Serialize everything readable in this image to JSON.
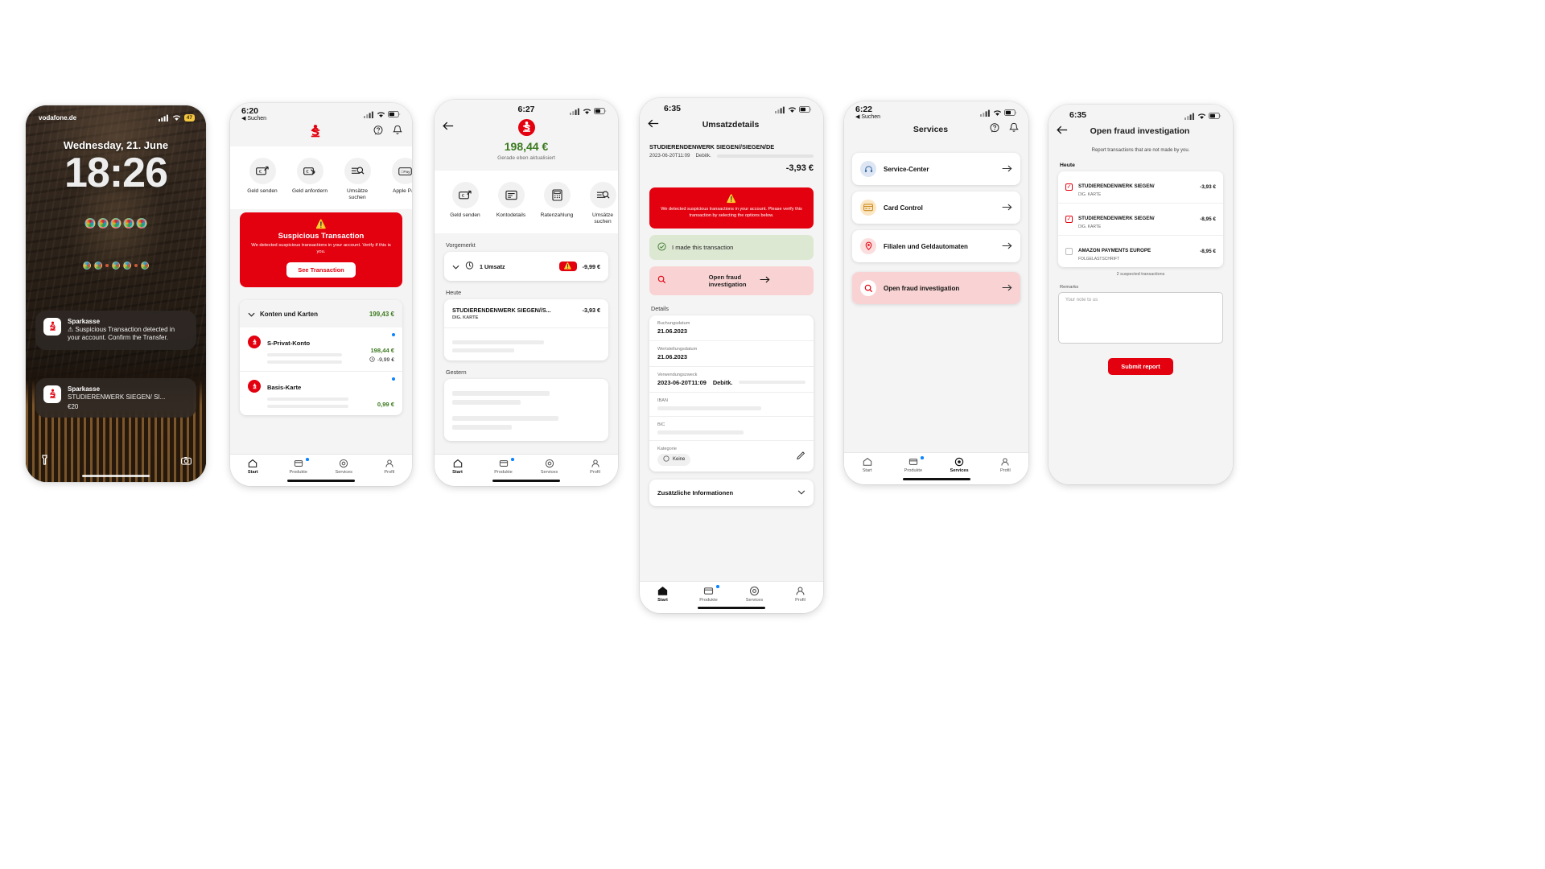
{
  "brand": {
    "name": "Sparkasse",
    "red": "#E3000F",
    "green": "#3B7A1E",
    "logo": "sparkasse-s-logo"
  },
  "phone1_lockscreen": {
    "carrier": "vodafone.de",
    "battery_badge": "47",
    "date": "Wednesday, 21. June",
    "time": "18:26",
    "notifications": [
      {
        "app": "Sparkasse",
        "text": "⚠ Suspicious Transaction detected in your account. Confirm the Transfer.",
        "amount": ""
      },
      {
        "app": "Sparkasse",
        "text": "STUDIERENWERK SIEGEN/ SI...",
        "amount": "€20"
      }
    ],
    "bottom_left_icon": "flashlight-icon",
    "bottom_right_icon": "camera-icon"
  },
  "phone2_home": {
    "status": {
      "time": "6:20",
      "back_label": "Suchen"
    },
    "nav": {
      "logo": "sparkasse-logo",
      "help_icon": "help-icon",
      "bell_icon": "bell-icon"
    },
    "quick_actions": [
      {
        "label": "Geld senden",
        "icon": "send-money-icon"
      },
      {
        "label": "Geld anfordern",
        "icon": "request-money-icon"
      },
      {
        "label": "Umsätze suchen",
        "icon": "search-transactions-icon"
      },
      {
        "label": "Apple Pay",
        "icon": "apple-pay-icon"
      }
    ],
    "alert": {
      "warn_icon": "warning-triangle-icon",
      "title": "Suspicious Transaction",
      "body": "We detected suspicious transactions in your account. Verify if this is you.",
      "button": "See Transaction"
    },
    "accounts": {
      "header": "Konten und Karten",
      "header_amount": "199,43 €",
      "chevron": "chevron-down-icon",
      "rows": [
        {
          "name": "S-Privat-Konto",
          "amount": "198,44 €",
          "sub_amount": "-9,99 €",
          "sub_icon": "pending-clock-icon",
          "has_dot": true
        },
        {
          "name": "Basis-Karte",
          "amount": "0,99 €",
          "sub_amount": "",
          "sub_icon": "",
          "has_dot": true
        }
      ]
    },
    "tabs": [
      {
        "label": "Start",
        "icon": "home-icon",
        "active": true,
        "dot": false
      },
      {
        "label": "Produkte",
        "icon": "products-icon",
        "active": false,
        "dot": true
      },
      {
        "label": "Services",
        "icon": "services-icon",
        "active": false,
        "dot": false
      },
      {
        "label": "Profil",
        "icon": "profile-icon",
        "active": false,
        "dot": false
      }
    ]
  },
  "phone3_account": {
    "status": {
      "time": "6:27"
    },
    "back_icon": "back-arrow-icon",
    "balance": "198,44 €",
    "balance_sub": "Gerade eben aktualisiert",
    "quick_actions": [
      {
        "label": "Geld senden",
        "icon": "send-money-icon"
      },
      {
        "label": "Kontodetails",
        "icon": "account-details-icon"
      },
      {
        "label": "Ratenzahlung",
        "icon": "installment-icon"
      },
      {
        "label": "Umsätze suchen",
        "icon": "search-transactions-icon"
      }
    ],
    "sections": [
      {
        "label": "Vorgemerkt",
        "rows": [
          {
            "name": "1 Umsatz",
            "amount": "-9,99 €",
            "icon": "pending-clock-icon",
            "chevron": "chevron-down-icon",
            "warn": true
          }
        ]
      },
      {
        "label": "Heute",
        "rows": [
          {
            "name": "STUDIERENDENWERK SIEGEN//S...",
            "sub": "DIG. KARTE",
            "amount": "-3,93 €"
          }
        ]
      },
      {
        "label": "Gestern",
        "rows": []
      }
    ],
    "tabs": [
      {
        "label": "Start",
        "active": true,
        "dot": false
      },
      {
        "label": "Produkte",
        "active": false,
        "dot": true
      },
      {
        "label": "Services",
        "active": false,
        "dot": false
      },
      {
        "label": "Profil",
        "active": false,
        "dot": false
      }
    ]
  },
  "phone4_details": {
    "status": {
      "time": "6:35"
    },
    "back_icon": "back-arrow-icon",
    "title": "Umsatzdetails",
    "merchant": "STUDIERENDENWERK SIEGEN//SIEGEN/DE",
    "meta_date": "2023-06-20T11:09",
    "meta_type": "Debitk.",
    "amount": "-3,93 €",
    "banner": {
      "warn_icon": "warning-triangle-icon",
      "text": "We detected suspicious transactions in your account. Please verify this transaction by selecting the options below."
    },
    "option_confirm": {
      "label": "I made this transaction",
      "icon": "check-circle-icon"
    },
    "option_fraud": {
      "label": "Open fraud investigation",
      "icon": "search-icon",
      "arrow": "arrow-right-icon"
    },
    "details_label": "Details",
    "details": [
      {
        "label": "Buchungsdatum",
        "value": "21.06.2023"
      },
      {
        "label": "Wertstellungsdatum",
        "value": "21.06.2023"
      },
      {
        "label": "Verwendungszweck",
        "value": "2023-06-20T11:09",
        "value2": "Debitk."
      },
      {
        "label": "IBAN",
        "value": ""
      },
      {
        "label": "BIC",
        "value": ""
      },
      {
        "label": "Kategorie",
        "value": "Keine",
        "edit_icon": "pencil-icon"
      }
    ],
    "extra_section": {
      "label": "Zusätzliche Informationen",
      "chevron": "chevron-down-icon"
    },
    "tabs": [
      {
        "label": "Start",
        "active": true,
        "dot": false
      },
      {
        "label": "Produkte",
        "active": false,
        "dot": true
      },
      {
        "label": "Services",
        "active": false,
        "dot": false
      },
      {
        "label": "Profil",
        "active": false,
        "dot": false
      }
    ]
  },
  "phone5_services": {
    "status": {
      "time": "6:22",
      "back_label": "Suchen"
    },
    "title": "Services",
    "help_icon": "help-icon",
    "bell_icon": "bell-icon",
    "items": [
      {
        "label": "Service-Center",
        "icon": "headset-icon",
        "arrow": "arrow-right-icon",
        "highlight": false
      },
      {
        "label": "Card Control",
        "icon": "card-icon",
        "arrow": "arrow-right-icon",
        "highlight": false
      },
      {
        "label": "Filialen und Geldautomaten",
        "icon": "location-icon",
        "arrow": "arrow-right-icon",
        "highlight": false
      },
      {
        "label": "Open fraud investigation",
        "icon": "search-icon",
        "arrow": "arrow-right-icon",
        "highlight": true
      }
    ],
    "tabs": [
      {
        "label": "Start",
        "active": false,
        "dot": false
      },
      {
        "label": "Produkte",
        "active": false,
        "dot": true
      },
      {
        "label": "Services",
        "active": true,
        "dot": false
      },
      {
        "label": "Profil",
        "active": false,
        "dot": false
      }
    ]
  },
  "phone6_report": {
    "status": {
      "time": "6:35"
    },
    "back_icon": "back-arrow-icon",
    "title": "Open fraud investigation",
    "subtitle": "Report transactions that are not made by you.",
    "section_label": "Heute",
    "rows": [
      {
        "name": "STUDIERENDENWERK SIEGEN/",
        "sub": "DIG. KARTE",
        "amount": "-3,93 €",
        "checked": true
      },
      {
        "name": "STUDIERENDENWERK SIEGEN/",
        "sub": "DIG. KARTE",
        "amount": "-8,95 €",
        "checked": true
      },
      {
        "name": "AMAZON PAYMENTS EUROPE",
        "sub": "FOLGELASTSCHRIFT",
        "amount": "-8,95 €",
        "checked": false
      }
    ],
    "count_text": "2 suspected transactions",
    "remarks_label": "Remarks",
    "remarks_placeholder": "Your note to us",
    "submit_label": "Submit report"
  }
}
